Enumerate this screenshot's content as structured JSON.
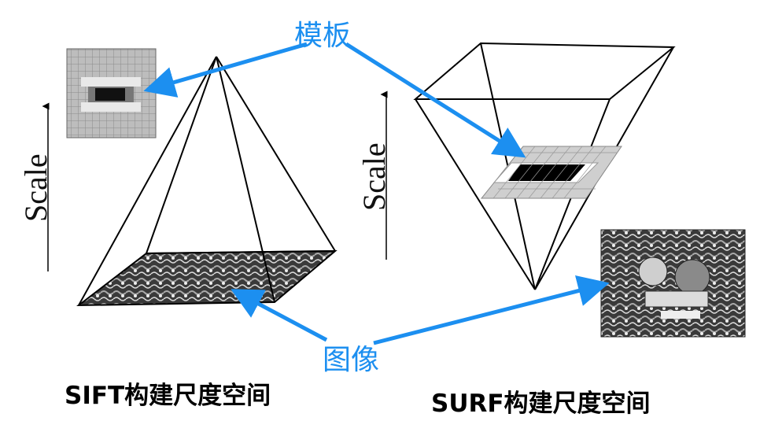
{
  "labels": {
    "template": "模板",
    "image": "图像",
    "scale_left": "Scale",
    "scale_right": "Scale",
    "sift_caption": "SIFT构建尺度空间",
    "surf_caption": "SURF构建尺度空间"
  },
  "colors": {
    "arrow": "#1c8ff0",
    "line": "#000000"
  }
}
